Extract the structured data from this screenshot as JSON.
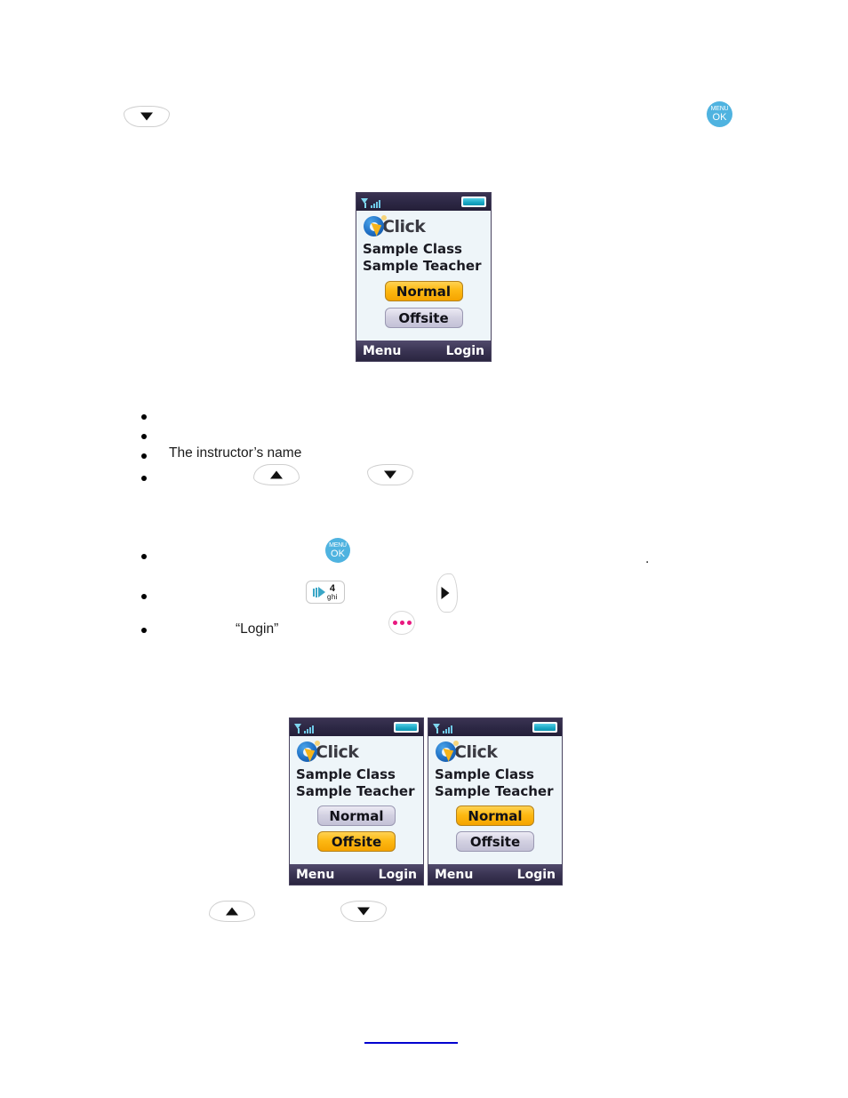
{
  "document": {
    "body_paragraphs": [
      {
        "id": "instructor_name",
        "text": "The instructor’s name"
      },
      {
        "id": "login_quoted",
        "text": "“Login”"
      }
    ],
    "bullets_group_one": [
      {
        "text": ""
      },
      {
        "text": ""
      },
      {
        "text": "The instructor’s name"
      },
      {
        "text": ""
      }
    ],
    "bullets_group_two": [
      {
        "text": ""
      },
      {
        "text": ""
      },
      {
        "text": "“Login”"
      }
    ],
    "period_mark": "."
  },
  "keys": {
    "down_arrow": {
      "name": "down-arrow-key",
      "glyph": "▼"
    },
    "up_arrow": {
      "name": "up-arrow-key",
      "glyph": "▲"
    },
    "right_arrow": {
      "name": "right-arrow-key",
      "glyph": "▶"
    },
    "menu_ok": {
      "name": "menu-ok-key",
      "line1": "MENU",
      "line2": "OK",
      "color": "#4fb3e0"
    },
    "num_four": {
      "name": "number-4-ghi-key",
      "number": "4",
      "letters": "ghi"
    },
    "more_dots": {
      "name": "three-dots-key",
      "dot_color": "#e8177f"
    }
  },
  "devices": [
    {
      "id": "device-top",
      "status_bar": {
        "signal_icon": "signal-bars-icon",
        "battery_icon": "battery-icon"
      },
      "logo_text": "Click",
      "class_name": "Sample Class",
      "teacher_name": "Sample Teacher",
      "buttons": [
        {
          "label": "Normal",
          "selected": true
        },
        {
          "label": "Offsite",
          "selected": false
        }
      ],
      "softkeys": {
        "left": "Menu",
        "right": "Login"
      }
    },
    {
      "id": "device-bottom-left",
      "status_bar": {
        "signal_icon": "signal-bars-icon",
        "battery_icon": "battery-icon"
      },
      "logo_text": "Click",
      "class_name": "Sample Class",
      "teacher_name": "Sample Teacher",
      "buttons": [
        {
          "label": "Normal",
          "selected": false
        },
        {
          "label": "Offsite",
          "selected": true
        }
      ],
      "softkeys": {
        "left": "Menu",
        "right": "Login"
      }
    },
    {
      "id": "device-bottom-right",
      "status_bar": {
        "signal_icon": "signal-bars-icon",
        "battery_icon": "battery-icon"
      },
      "logo_text": "Click",
      "class_name": "Sample Class",
      "teacher_name": "Sample Teacher",
      "buttons": [
        {
          "label": "Normal",
          "selected": true
        },
        {
          "label": "Offsite",
          "selected": false
        }
      ],
      "softkeys": {
        "left": "Menu",
        "right": "Login"
      }
    }
  ],
  "theme": {
    "selected_button_color": "#fdb913",
    "unselected_button_color": "#d3d1e2",
    "device_screen_bg": "#eef5f9",
    "status_bar_color": "#2c2744",
    "softkey_bar_color": "#3a3453",
    "footer_rule_color": "#0000d0",
    "menu_key_color": "#4fb3e0",
    "dots_key_color": "#e8177f"
  }
}
